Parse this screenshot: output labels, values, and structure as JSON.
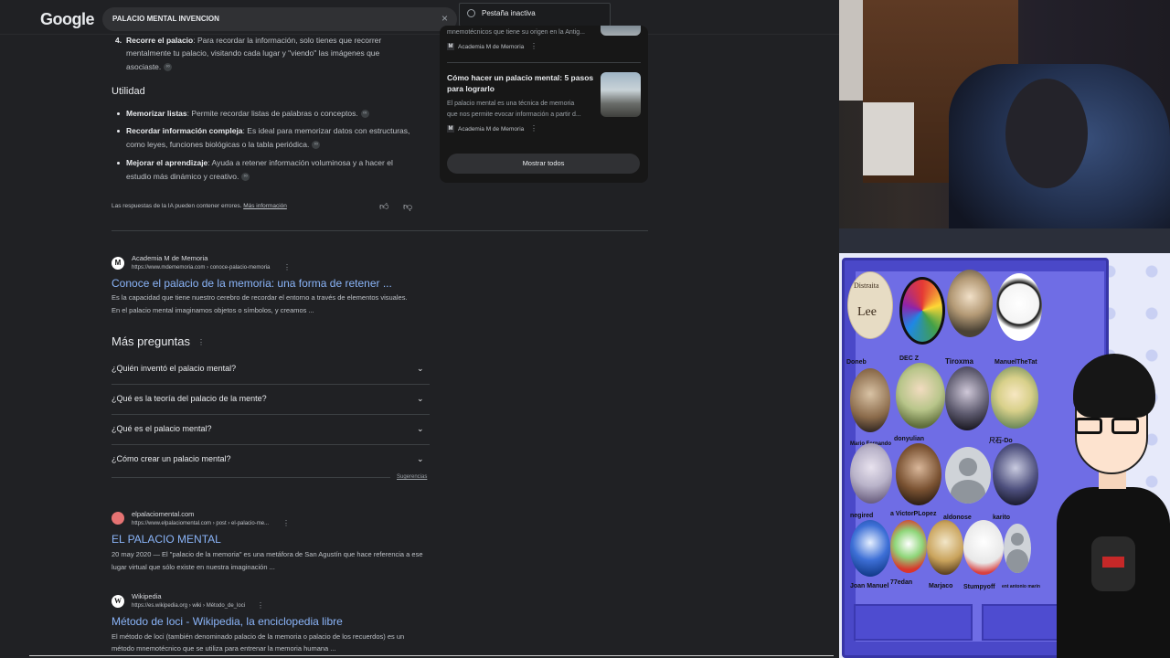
{
  "google": {
    "logo": "Google",
    "search_query": "PALACIO MENTAL INVENCION",
    "clear_icon": "×",
    "tab_tooltip": "Pestaña inactiva",
    "ai": {
      "step4_bold": "Recorre el palacio",
      "step4_text_1": ": Para recordar la información, solo tienes que recorrer",
      "step4_text_2": "mentalmente tu palacio, visitando cada lugar y \"viendo\" las imágenes que",
      "step4_text_3": "asociaste.",
      "step4_num": "4.",
      "utilidad": "Utilidad",
      "b1_bold": "Memorizar listas",
      "b1_text": ": Permite recordar listas de palabras o conceptos.",
      "b2_bold": "Recordar información compleja",
      "b2_text_1": ": Es ideal para memorizar datos con estructuras,",
      "b2_text_2": "como leyes, funciones biológicas o la tabla periódica.",
      "b3_bold": "Mejorar el aprendizaje",
      "b3_text_1": ": Ayuda a retener información voluminosa y a hacer el",
      "b3_text_2": "estudio más dinámico y creativo.",
      "footer_text": "Las respuestas de la IA pueden contener errores. ",
      "footer_link": "Más información"
    },
    "sources": {
      "top_snip": "mnemotécnicos que tiene su origen en la Antig...",
      "top_site": "Academia M de Memoria",
      "card_title_1": "Cómo hacer un palacio mental: 5 pasos",
      "card_title_2": "para lograrlo",
      "card_snip_1": "El palacio mental es una técnica de memoria",
      "card_snip_2": "que nos permite evocar información a partir d...",
      "card_site": "Academia M de Memoria",
      "show_all": "Mostrar todos",
      "fav": "M"
    },
    "results": [
      {
        "site": "Academia M de Memoria",
        "url": "https://www.mdememoria.com › conoce-palacio-memoria",
        "title": "Conoce el palacio de la memoria: una forma de retener ...",
        "snip1": "Es la capacidad que tiene nuestro cerebro de recordar el entorno a través de elementos visuales.",
        "snip2": "En el palacio mental imaginamos objetos o símbolos, y creamos ...",
        "fav": "M"
      },
      {
        "site": "elpalaciomental.com",
        "url": "https://www.elpalaciomental.com › post › el-palacio-me...",
        "title": "EL PALACIO MENTAL",
        "snip1": "20 may 2020 — El \"palacio de la memoria\" es una metáfora de San Agustín que hace referencia a ese",
        "snip2": "lugar virtual que sólo existe en nuestra imaginación ...",
        "fav": ""
      },
      {
        "site": "Wikipedia",
        "url": "https://es.wikipedia.org › wiki › Método_de_loci",
        "title": "Método de loci - Wikipedia, la enciclopedia libre",
        "snip1": "El método de loci (también denominado palacio de la memoria o palacio de los recuerdos) es un",
        "snip2": "método mnemotécnico que se utiliza para entrenar la memoria humana ...",
        "fav": "W"
      }
    ],
    "paa": {
      "title": "Más preguntas",
      "questions": [
        "¿Quién inventó el palacio mental?",
        "¿Qué es la teoría del palacio de la mente?",
        "¿Qué es el palacio mental?",
        "¿Cómo crear un palacio mental?"
      ],
      "sugerencias": "Sugerencias"
    }
  },
  "sidebar": {
    "avatar_names": [
      "Doneb",
      "DEC Z",
      "Tiroxma",
      "ManuelTheTat",
      "Mario Fernando",
      "donyulian",
      "",
      "尺石-Do",
      "negired",
      "a VictorPLopez",
      "aldonose",
      "karito",
      "Joan Manuel",
      "77edan",
      "Marjaco",
      "Stumpyoff",
      "ent antonio marin"
    ],
    "logo_text_1": "Distraita",
    "logo_text_2": "Lee",
    "colors": {
      "panel": "#4a48c8",
      "panel_inner": "#6f6de5",
      "background": "#e4e8fb"
    }
  }
}
